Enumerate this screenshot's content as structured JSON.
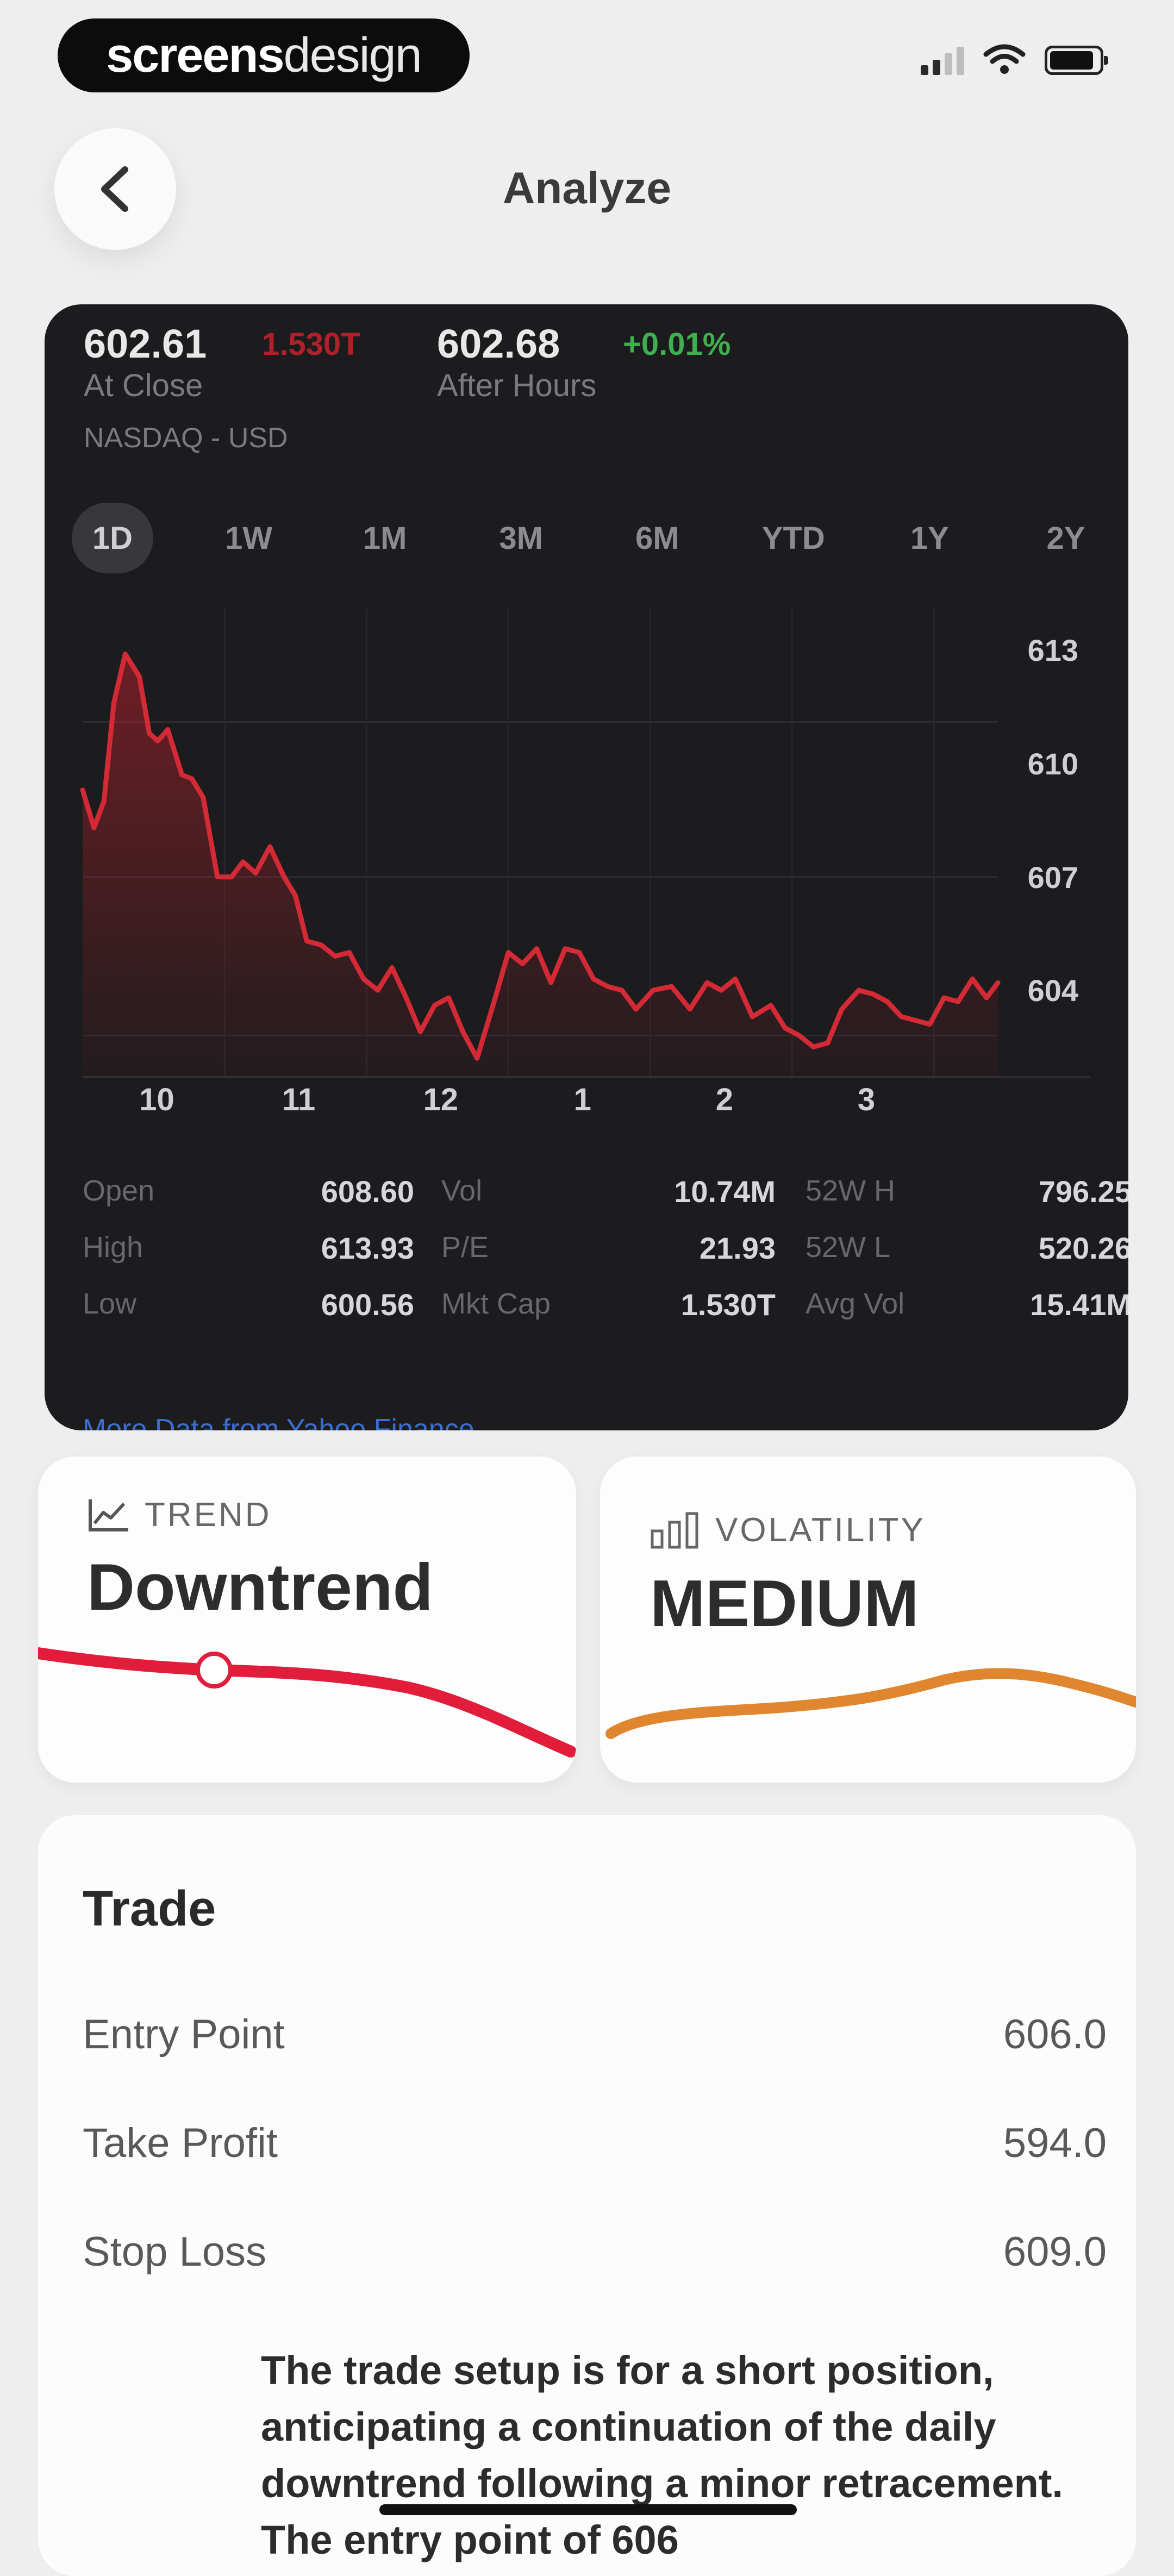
{
  "status_bar": {
    "logo_bold": "screens",
    "logo_light": "design"
  },
  "header": {
    "title": "Analyze"
  },
  "quote": {
    "close_price": "602.61",
    "close_change": "1.530T",
    "close_label": "At Close",
    "after_price": "602.68",
    "after_change": "+0.01%",
    "after_label": "After Hours",
    "exchange": "NASDAQ - USD"
  },
  "ranges": [
    "1D",
    "1W",
    "1M",
    "3M",
    "6M",
    "YTD",
    "1Y",
    "2Y"
  ],
  "chart_data": {
    "type": "area",
    "title": "",
    "xlabel": "",
    "ylabel": "",
    "x_tick_labels": [
      "10",
      "11",
      "12",
      "1",
      "2",
      "3"
    ],
    "y_tick_labels": [
      "613",
      "610",
      "607",
      "604"
    ],
    "ylim": [
      601.7,
      614.1
    ],
    "color": "#d42a36",
    "series": [
      {
        "x": [
          9.5,
          9.58,
          9.65,
          9.72,
          9.8,
          9.9,
          9.97,
          10.03,
          10.1,
          10.2,
          10.27,
          10.35,
          10.45,
          10.55,
          10.63,
          10.72,
          10.82,
          10.92,
          11.0,
          11.08,
          11.18,
          11.28,
          11.38,
          11.48,
          11.58,
          11.68,
          11.78,
          11.88,
          11.98,
          12.08,
          12.18,
          12.28,
          12.4,
          12.5,
          12.6,
          12.7,
          12.8,
          12.9,
          13.0,
          13.1,
          13.2,
          13.3,
          13.4,
          13.52,
          13.65,
          13.78,
          13.9,
          14.0,
          14.1,
          14.22,
          14.35,
          14.45,
          14.55,
          14.65,
          14.75,
          14.85,
          14.97,
          15.07,
          15.17,
          15.27,
          15.37,
          15.47,
          15.57,
          15.67,
          15.77,
          15.87,
          15.95
        ],
        "y": [
          609.3,
          608.3,
          609.0,
          611.6,
          612.9,
          612.3,
          610.8,
          610.6,
          610.9,
          609.7,
          609.6,
          609.1,
          607.0,
          607.0,
          607.4,
          607.1,
          607.8,
          607.0,
          606.5,
          605.3,
          605.2,
          604.9,
          605.0,
          604.3,
          604.0,
          604.6,
          603.8,
          602.9,
          603.6,
          603.8,
          602.9,
          602.2,
          603.7,
          605.0,
          604.7,
          605.1,
          604.2,
          605.1,
          605.0,
          604.3,
          604.1,
          604.0,
          603.5,
          604.0,
          604.1,
          603.5,
          604.2,
          604.0,
          604.3,
          603.3,
          603.6,
          603.0,
          602.8,
          602.5,
          602.6,
          603.5,
          604.0,
          603.9,
          603.7,
          603.3,
          603.2,
          603.1,
          603.8,
          603.7,
          604.3,
          603.8,
          604.2
        ]
      }
    ]
  },
  "stats": [
    {
      "label": "Open",
      "value": "608.60"
    },
    {
      "label": "Vol",
      "value": "10.74M"
    },
    {
      "label": "52W H",
      "value": "796.25"
    },
    {
      "label": "High",
      "value": "613.93"
    },
    {
      "label": "P/E",
      "value": "21.93"
    },
    {
      "label": "52W L",
      "value": "520.26"
    },
    {
      "label": "Low",
      "value": "600.56"
    },
    {
      "label": "Mkt Cap",
      "value": "1.530T"
    },
    {
      "label": "Avg Vol",
      "value": "15.41M"
    }
  ],
  "more_link": "More Data from Yahoo Finance",
  "trend": {
    "label": "TREND",
    "value": "Downtrend",
    "color": "#e21d3b",
    "icon": "line-chart-icon"
  },
  "volatility": {
    "label": "VOLATILITY",
    "value": "MEDIUM",
    "color": "#e0862f",
    "icon": "bar-chart-icon"
  },
  "trade": {
    "title": "Trade",
    "rows": [
      {
        "label": "Entry Point",
        "value": "606.0"
      },
      {
        "label": "Take Profit",
        "value": "594.0"
      },
      {
        "label": "Stop Loss",
        "value": "609.0"
      }
    ],
    "note": "The trade setup is for a short position, anticipating a continuation of the daily downtrend following a minor retracement. The entry point of 606"
  }
}
